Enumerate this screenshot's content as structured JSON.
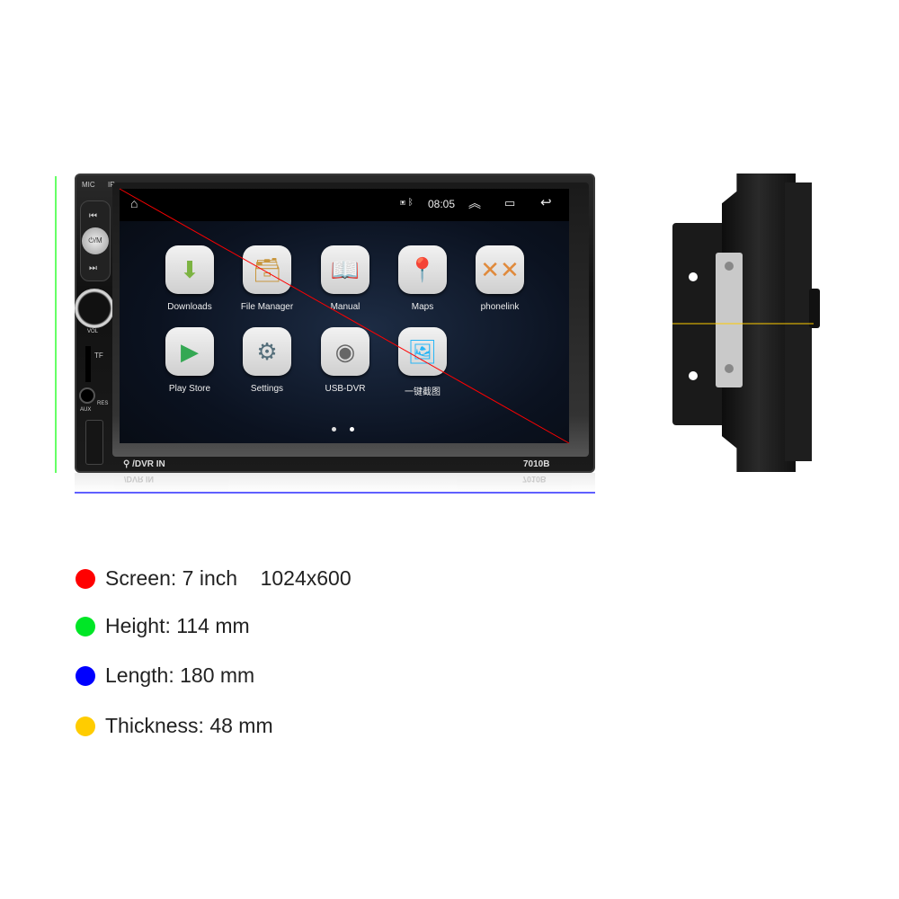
{
  "device": {
    "model": "7010B",
    "dvr_label": "/DVR IN",
    "panel_labels": {
      "mic": "MIC",
      "ir": "IR",
      "prev": "⏮",
      "power_mode": "⏻/M",
      "next": "⏭",
      "vol": "VOL",
      "tf": "TF",
      "aux": "AUX",
      "res": "RES"
    }
  },
  "screen": {
    "status": {
      "time": "08:05",
      "icons": [
        "home-icon",
        "bluetooth-icon",
        "expand-icon",
        "recents-icon",
        "back-icon"
      ]
    },
    "apps": [
      {
        "label": "Downloads",
        "icon": "download-icon",
        "glyph": "⬇",
        "color": "#7cb342"
      },
      {
        "label": "File Manager",
        "icon": "file-manager-icon",
        "glyph": "🗃",
        "color": "#c8963e"
      },
      {
        "label": "Manual",
        "icon": "book-icon",
        "glyph": "📖",
        "color": "#1e88e5"
      },
      {
        "label": "Maps",
        "icon": "maps-icon",
        "glyph": "📍",
        "color": "#e53935"
      },
      {
        "label": "phonelink",
        "icon": "phonelink-icon",
        "glyph": "✕✕",
        "color": "#e08a3c"
      },
      {
        "label": "Play Store",
        "icon": "play-store-icon",
        "glyph": "▶",
        "color": "#34a853"
      },
      {
        "label": "Settings",
        "icon": "gear-icon",
        "glyph": "⚙",
        "color": "#546e7a"
      },
      {
        "label": "USB-DVR",
        "icon": "camera-icon",
        "glyph": "◉",
        "color": "#666"
      },
      {
        "label": "一键截图",
        "icon": "screenshot-icon",
        "glyph": "🖼",
        "color": "#29b6f6"
      }
    ],
    "page_count": 2,
    "active_page": 2
  },
  "dimension_colors": {
    "screen": "#ff0000",
    "height": "#00ff00",
    "length": "#0000ff",
    "thickness": "#ffcc00"
  },
  "legend": [
    {
      "text": "Screen: 7 inch    1024x600",
      "color": "#ff0000"
    },
    {
      "text": "Height: 114 mm",
      "color": "#00e626"
    },
    {
      "text": "Length: 180 mm",
      "color": "#0000ff"
    },
    {
      "text": "Thickness: 48 mm",
      "color": "#ffcc00"
    }
  ]
}
